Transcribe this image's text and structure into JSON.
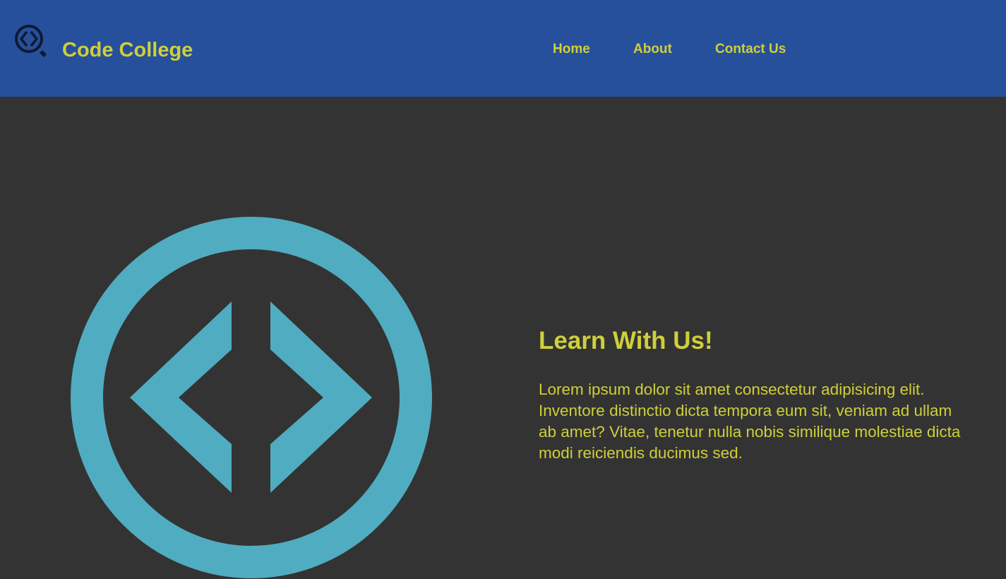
{
  "colors": {
    "header_bg": "#26509b",
    "page_bg": "#333333",
    "accent_text": "#cfcf3a",
    "logo_color": "#50acc0",
    "icon_dark": "#0e1a33"
  },
  "brand": {
    "icon": "code-college-logo-icon",
    "name": "Code College"
  },
  "nav": {
    "items": [
      {
        "label": "Home"
      },
      {
        "label": "About"
      },
      {
        "label": "Contact Us"
      }
    ]
  },
  "hero": {
    "image_icon": "code-brackets-circle-logo",
    "heading": "Learn With Us!",
    "body": "Lorem ipsum dolor sit amet consectetur adipisicing elit. Inventore distinctio dicta tempora eum sit, veniam ad ullam ab amet? Vitae, tenetur nulla nobis similique molestiae dicta modi reiciendis ducimus sed."
  }
}
